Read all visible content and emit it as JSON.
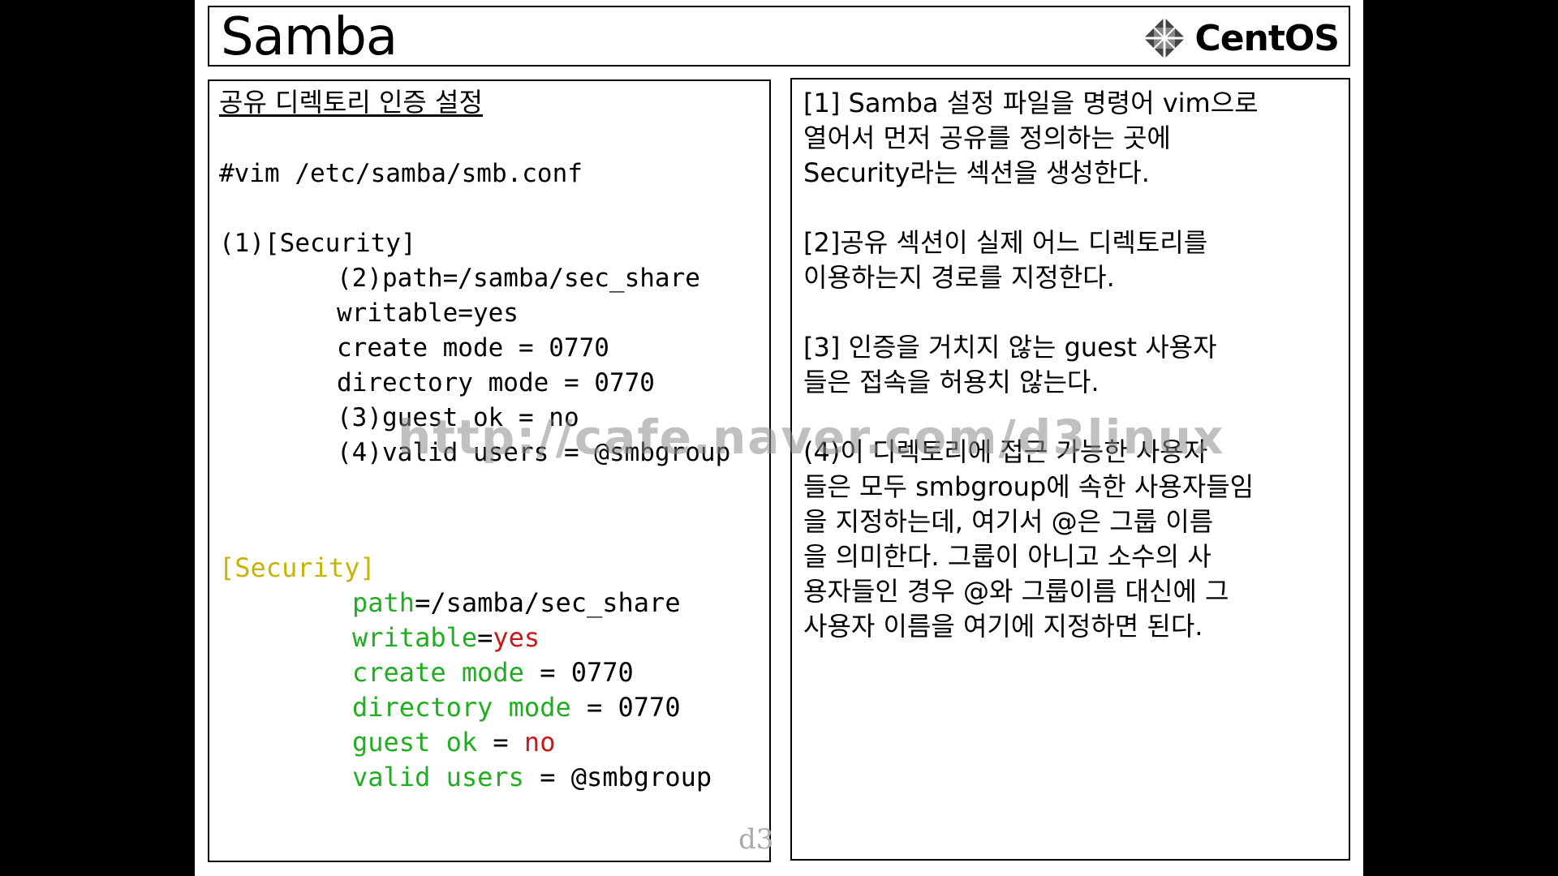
{
  "title": "Samba",
  "logo": {
    "text": "CentOS",
    "icon": "centos-logo-icon"
  },
  "left": {
    "heading": "공유 디렉토리 인증 설정",
    "command": "#vim /etc/samba/smb.conf",
    "annotated": [
      "(1)[Security]",
      "(2)path=/samba/sec_share",
      "writable=yes",
      "create mode = 0770",
      "directory mode = 0770",
      "(3)guest ok = no",
      "(4)valid users = @smbgroup"
    ],
    "colored": {
      "section": "[Security]",
      "path_key": "path",
      "path_val": "=/samba/sec_share",
      "writable_key": "writable",
      "writable_eq": "=",
      "writable_val": "yes",
      "create_key": "create mode",
      "create_val": " = 0770",
      "dir_key": "directory mode",
      "dir_val": " = 0770",
      "guest_key": "guest ok",
      "guest_eq": " = ",
      "guest_val": "no",
      "valid_key": "valid users",
      "valid_val": " = @smbgroup"
    },
    "signature": "d3"
  },
  "right": {
    "p1": "[1] Samba 설정 파일을 명령어 vim으로\n열어서 먼저 공유를 정의하는 곳에\nSecurity라는 섹션을 생성한다.",
    "p2": "[2]공유 섹션이 실제 어느 디렉토리를\n이용하는지 경로를 지정한다.",
    "p3": "[3] 인증을 거치지 않는 guest 사용자\n들은 접속을 허용치 않는다.",
    "p4": "(4)이 디렉토리에 접근 가능한 사용자\n들은 모두 smbgroup에 속한 사용자들임\n을 지정하는데, 여기서 @은 그룹 이름\n을 의미한다. 그룹이 아니고 소수의 사\n용자들인 경우 @와 그룹이름 대신에 그\n사용자 이름을 여기에 지정하면 된다."
  },
  "watermark": "http://cafe.naver.com/d3linux",
  "colors": {
    "yellow": "#c8b400",
    "green": "#1fae1f",
    "red": "#c81818"
  }
}
